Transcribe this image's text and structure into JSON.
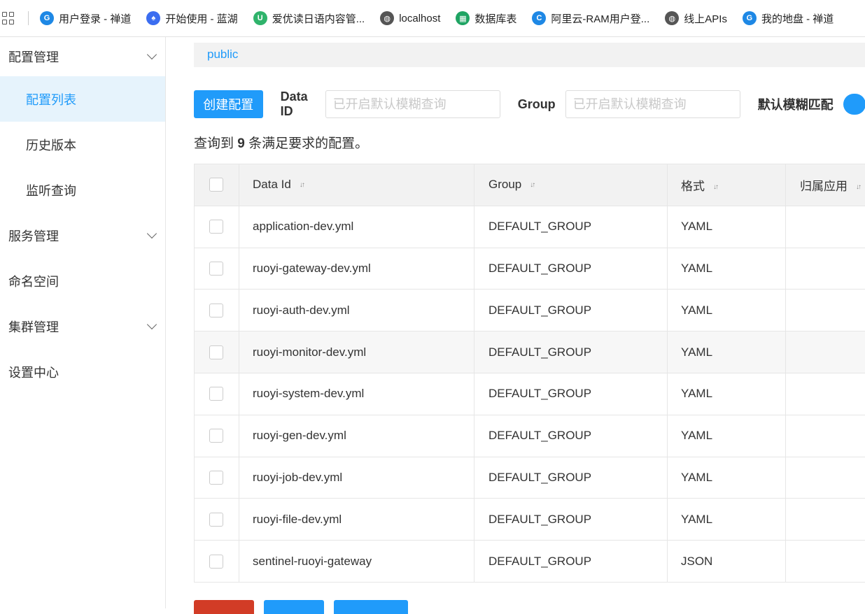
{
  "bookmarks": [
    {
      "label": "用户登录 - 禅道",
      "icon": "zentao-icon",
      "color": "#1e88e5"
    },
    {
      "label": "开始使用 - 蓝湖",
      "icon": "lanhu-icon",
      "color": "#3b6df0"
    },
    {
      "label": "爱优读日语内容管...",
      "icon": "u-logo-icon",
      "color": "#2fb36b"
    },
    {
      "label": "localhost",
      "icon": "globe-icon",
      "color": "#555555"
    },
    {
      "label": "数据库表",
      "icon": "sheet-icon",
      "color": "#1fa463"
    },
    {
      "label": "阿里云-RAM用户登...",
      "icon": "aliyun-icon",
      "color": "#1e88e5"
    },
    {
      "label": "线上APIs",
      "icon": "globe-icon",
      "color": "#555555"
    },
    {
      "label": "我的地盘 - 禅道",
      "icon": "zentao-icon",
      "color": "#1e88e5"
    }
  ],
  "sidebar": {
    "config_mgmt": "配置管理",
    "config_list": "配置列表",
    "history": "历史版本",
    "listen_query": "监听查询",
    "service_mgmt": "服务管理",
    "namespace": "命名空间",
    "cluster_mgmt": "集群管理",
    "settings": "设置中心"
  },
  "namespace": "public",
  "toolbar": {
    "create_label": "创建配置",
    "data_id_label": "Data ID",
    "data_id_placeholder": "已开启默认模糊查询",
    "group_label": "Group",
    "group_placeholder": "已开启默认模糊查询",
    "fuzzy_label": "默认模糊匹配"
  },
  "result": {
    "prefix": "查询到",
    "count": "9",
    "suffix": "条满足要求的配置。"
  },
  "table": {
    "headers": {
      "data_id": "Data Id",
      "group": "Group",
      "format": "格式",
      "app": "归属应用"
    },
    "rows": [
      {
        "data_id": "application-dev.yml",
        "group": "DEFAULT_GROUP",
        "format": "YAML"
      },
      {
        "data_id": "ruoyi-gateway-dev.yml",
        "group": "DEFAULT_GROUP",
        "format": "YAML"
      },
      {
        "data_id": "ruoyi-auth-dev.yml",
        "group": "DEFAULT_GROUP",
        "format": "YAML"
      },
      {
        "data_id": "ruoyi-monitor-dev.yml",
        "group": "DEFAULT_GROUP",
        "format": "YAML"
      },
      {
        "data_id": "ruoyi-system-dev.yml",
        "group": "DEFAULT_GROUP",
        "format": "YAML"
      },
      {
        "data_id": "ruoyi-gen-dev.yml",
        "group": "DEFAULT_GROUP",
        "format": "YAML"
      },
      {
        "data_id": "ruoyi-job-dev.yml",
        "group": "DEFAULT_GROUP",
        "format": "YAML"
      },
      {
        "data_id": "ruoyi-file-dev.yml",
        "group": "DEFAULT_GROUP",
        "format": "YAML"
      },
      {
        "data_id": "sentinel-ruoyi-gateway",
        "group": "DEFAULT_GROUP",
        "format": "JSON"
      }
    ]
  },
  "colors": {
    "primary": "#209bfa",
    "danger": "#d23c26"
  }
}
